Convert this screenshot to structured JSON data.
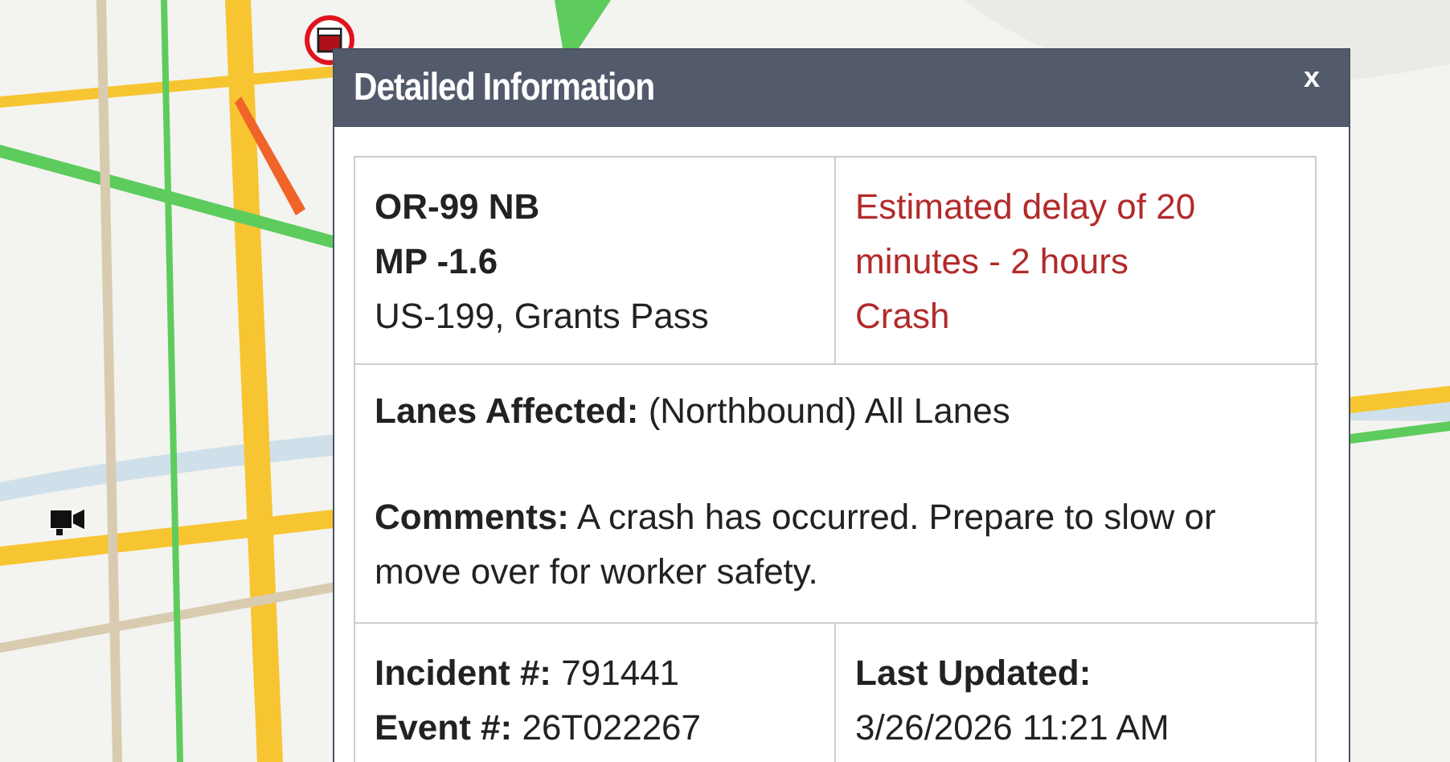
{
  "popup": {
    "title": "Detailed Information",
    "close": "x",
    "location": {
      "route": "OR-99 NB",
      "milepost": "MP -1.6",
      "place": "US-199, Grants Pass"
    },
    "delay": {
      "estimate": "Estimated delay of 20 minutes - 2 hours",
      "type": "Crash"
    },
    "details": [
      "**Lanes Affected:** (Northbound) All Lanes",
      "**Comments:** A crash has occurred. Prepare to slow or move over for worker safety."
    ],
    "ids": [
      "**Incident #:** 791441",
      "**Event #:** 26T022267"
    ],
    "updated": {
      "label": "Last Updated:",
      "value": "3/26/2026 11:21 AM"
    }
  }
}
